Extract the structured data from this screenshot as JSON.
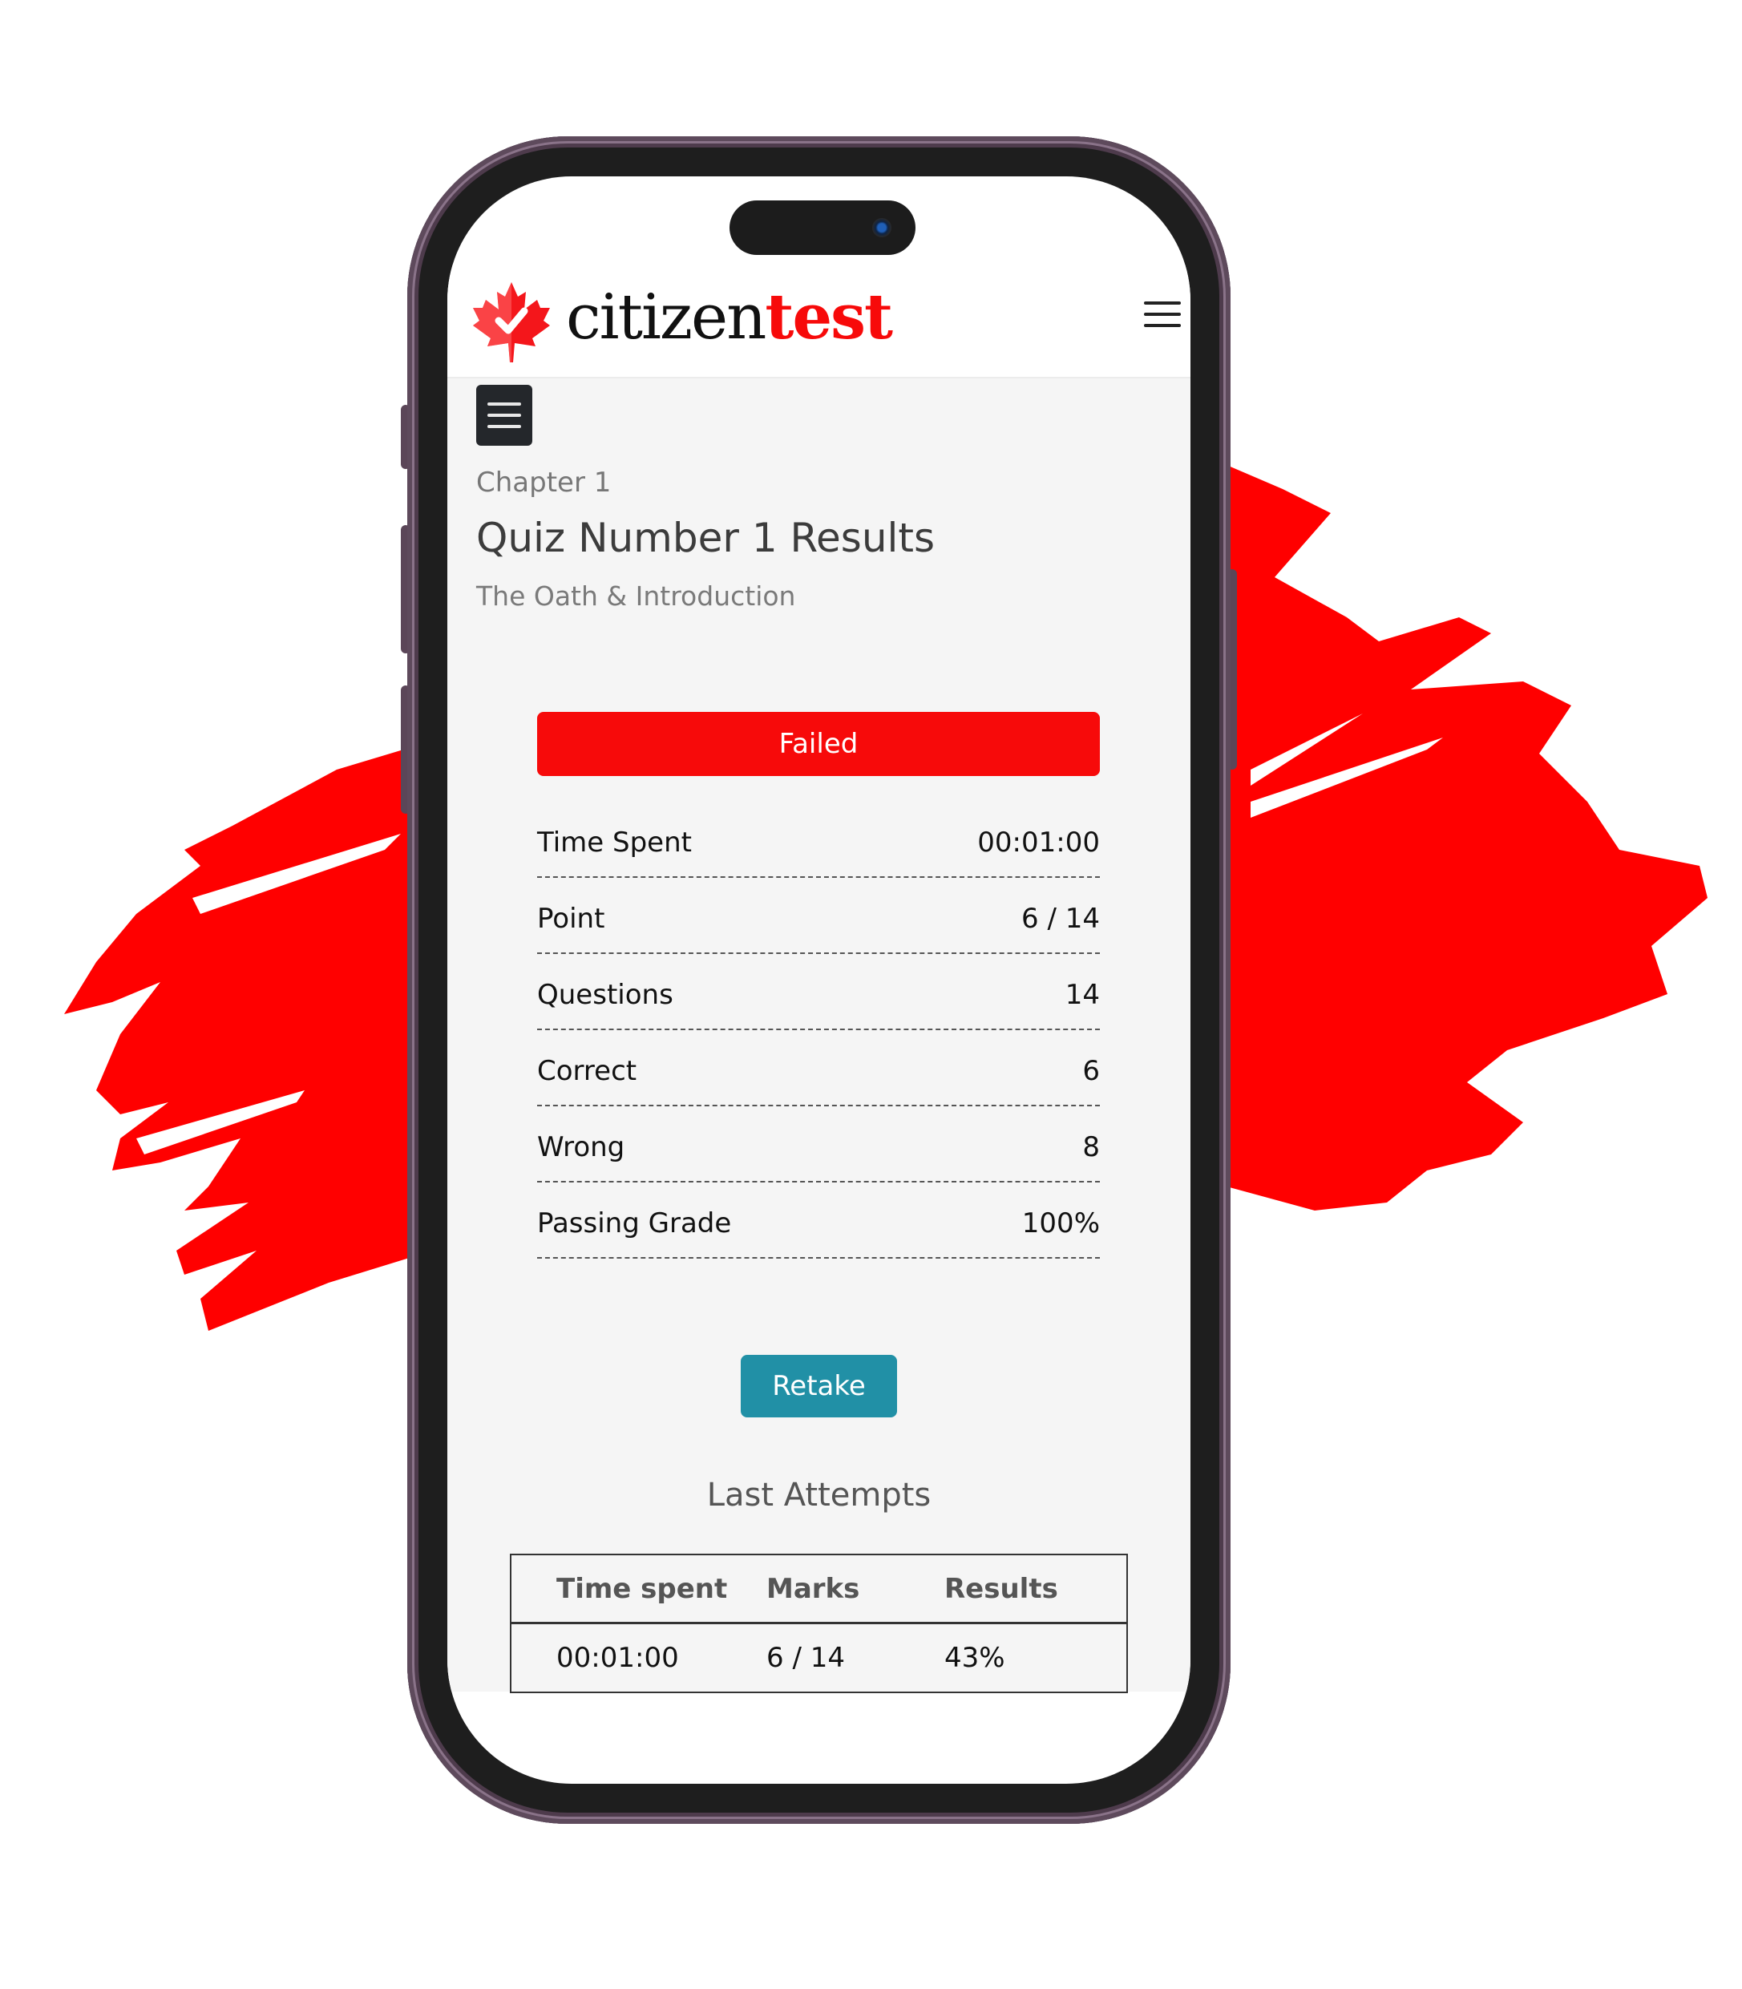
{
  "brand": {
    "name_part1": "citizen",
    "name_part2": "test",
    "accent_color": "#f70a0a",
    "logo_icon": "maple-leaf-check-icon"
  },
  "header": {
    "menu_icon": "hamburger-menu-icon"
  },
  "sidebar_toggle": {
    "icon": "hamburger-menu-icon"
  },
  "page": {
    "chapter": "Chapter 1",
    "title": "Quiz Number 1 Results",
    "subtitle": "The Oath & Introduction"
  },
  "result": {
    "status": "Failed",
    "status_color": "#f70a0a"
  },
  "stats": [
    {
      "label": "Time Spent",
      "value": "00:01:00"
    },
    {
      "label": "Point",
      "value": "6 / 14"
    },
    {
      "label": "Questions",
      "value": "14"
    },
    {
      "label": "Correct",
      "value": "6"
    },
    {
      "label": "Wrong",
      "value": "8"
    },
    {
      "label": "Passing Grade",
      "value": "100%"
    }
  ],
  "actions": {
    "retake_label": "Retake",
    "retake_color": "#2190a6"
  },
  "attempts": {
    "heading": "Last Attempts",
    "columns": [
      "Time spent",
      "Marks",
      "Results"
    ],
    "rows": [
      [
        "00:01:00",
        "6 / 14",
        "43%"
      ]
    ]
  }
}
